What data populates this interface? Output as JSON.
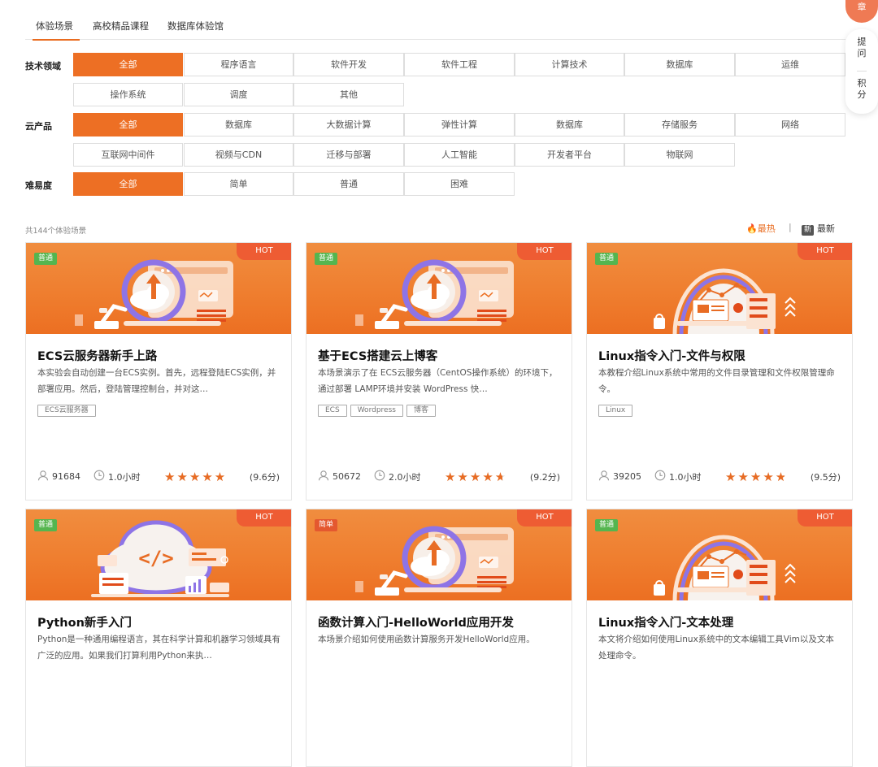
{
  "tabs": [
    "体验场景",
    "高校精品课程",
    "数据库体验馆"
  ],
  "filters": {
    "field": {
      "label": "技术领域",
      "options": [
        "全部",
        "程序语言",
        "软件开发",
        "软件工程",
        "计算技术",
        "数据库",
        "运维",
        "操作系统",
        "调度",
        "其他"
      ]
    },
    "product": {
      "label": "云产品",
      "options": [
        "全部",
        "数据库",
        "大数据计算",
        "弹性计算",
        "数据库",
        "存储服务",
        "网络",
        "互联网中间件",
        "视频与CDN",
        "迁移与部署",
        "人工智能",
        "开发者平台",
        "物联网"
      ]
    },
    "difficulty": {
      "label": "难易度",
      "options": [
        "全部",
        "简单",
        "普通",
        "困难"
      ]
    }
  },
  "result_count": "共144个体验场景",
  "sort": {
    "hot": "最热",
    "sep": "|",
    "new_badge": "新",
    "new": "最新"
  },
  "side": {
    "top": "章",
    "ask": "提问",
    "points": "积分"
  },
  "cards": [
    {
      "level": "普通",
      "hot": "HOT",
      "title": "ECS云服务器新手上路",
      "desc": "本实验会自动创建一台ECS实例。首先，远程登陆ECS实例，并部署应用。然后，登陆管理控制台，并对这…",
      "tags": [
        "ECS云服务器"
      ],
      "users": "91684",
      "time": "1.0小时",
      "stars": "★★★★★",
      "rating": 4.8,
      "score": "(9.6分)",
      "art": "cloud-upload"
    },
    {
      "level": "普通",
      "hot": "HOT",
      "title": "基于ECS搭建云上博客",
      "desc": "本场景演示了在 ECS云服务器（CentOS操作系统）的环境下，通过部署 LAMP环境并安装 WordPress 快…",
      "tags": [
        "ECS",
        "Wordpress",
        "博客"
      ],
      "users": "50672",
      "time": "2.0小时",
      "stars": "★★★★★",
      "rating": 4.6,
      "score": "(9.2分)",
      "art": "cloud-upload"
    },
    {
      "level": "普通",
      "hot": "HOT",
      "title": "Linux指令入门-文件与权限",
      "desc": "本教程介绍Linux系统中常用的文件目录管理和文件权限管理命令。",
      "tags": [
        "Linux"
      ],
      "users": "39205",
      "time": "1.0小时",
      "stars": "★★★★★",
      "rating": 4.75,
      "score": "(9.5分)",
      "art": "server-chart"
    },
    {
      "level": "普通",
      "hot": "HOT",
      "title": "Python新手入门",
      "desc": "Python是一种通用编程语言，其在科学计算和机器学习领域具有广泛的应用。如果我们打算利用Python来执…",
      "tags": [],
      "art": "code-cloud"
    },
    {
      "level": "简单",
      "hot": "HOT",
      "title": "函数计算入门-HelloWorld应用开发",
      "desc": "本场景介绍如何使用函数计算服务开发HelloWorld应用。",
      "tags": [],
      "art": "cloud-upload"
    },
    {
      "level": "普通",
      "hot": "HOT",
      "title": "Linux指令入门-文本处理",
      "desc": "本文将介绍如何使用Linux系统中的文本编辑工具Vim以及文本处理命令。",
      "tags": [],
      "art": "server-chart"
    }
  ]
}
